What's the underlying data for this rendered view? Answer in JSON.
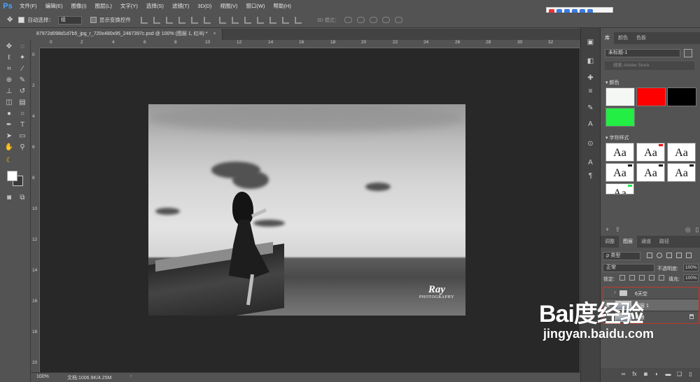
{
  "app": {
    "logo": "Ps",
    "menu": [
      "文件(F)",
      "编辑(E)",
      "图像(I)",
      "图层(L)",
      "文字(Y)",
      "选择(S)",
      "滤镜(T)",
      "3D(D)",
      "视图(V)",
      "窗口(W)",
      "帮助(H)"
    ]
  },
  "options_bar": {
    "auto_select_label": "自动选择：",
    "auto_select_value": "组",
    "show_transform_label": "显示变换控件",
    "mode_3d_label": "3D 模式："
  },
  "document": {
    "tab_title": "87972d098d1d7b5_jpg_r_720x480x95_2467397c.psd @ 100% (图层 1, 红/8) *",
    "close_glyph": "×",
    "ruler_top": [
      "0",
      "2",
      "4",
      "6",
      "8",
      "10",
      "12",
      "14",
      "16",
      "18",
      "20",
      "22",
      "24",
      "26",
      "28",
      "30",
      "32"
    ],
    "ruler_left": [
      "0",
      "2",
      "4",
      "6",
      "8",
      "10",
      "12",
      "14",
      "16",
      "18",
      "20"
    ]
  },
  "photo": {
    "watermark_brand": "Ray",
    "watermark_sub": "PHOTOGRAPHY"
  },
  "status": {
    "zoom": "100%",
    "doc_info": "文档:1006.9K/4.25M",
    "arrow": "›"
  },
  "panel": {
    "tabs": [
      "库",
      "颜色",
      "色板"
    ],
    "library_name": "未标题-1",
    "search_placeholder": "搜索 Adobe Stock",
    "colors_title": "颜色",
    "swatches": [
      "#f4f7f4",
      "#ff0000",
      "#000000",
      "#22ee44"
    ],
    "char_styles_title": "字符样式",
    "font_sample": "Aa",
    "layer_tabs": [
      "调整",
      "图层",
      "通道",
      "路径"
    ],
    "kind_label": "类型",
    "blend_mode": "正常",
    "opacity_label": "不透明度:",
    "opacity_value": "100%",
    "lock_label": "锁定:",
    "fill_label": "填充:",
    "fill_value": "100%",
    "layers": [
      {
        "name": "6天空",
        "type": "group",
        "visible": false,
        "selected": false
      },
      {
        "name": "图层 1",
        "type": "layer",
        "visible": true,
        "selected": true
      },
      {
        "name": "背景",
        "type": "layer",
        "visible": false,
        "selected": false,
        "locked": true
      }
    ],
    "bottom_icons": [
      "link-icon",
      "fx-icon",
      "mask-icon",
      "adjustment-icon",
      "folder-icon",
      "new-layer-icon",
      "trash-icon"
    ]
  },
  "overlay": {
    "brand": "Bai度经验",
    "url": "jingyan.baidu.com"
  }
}
